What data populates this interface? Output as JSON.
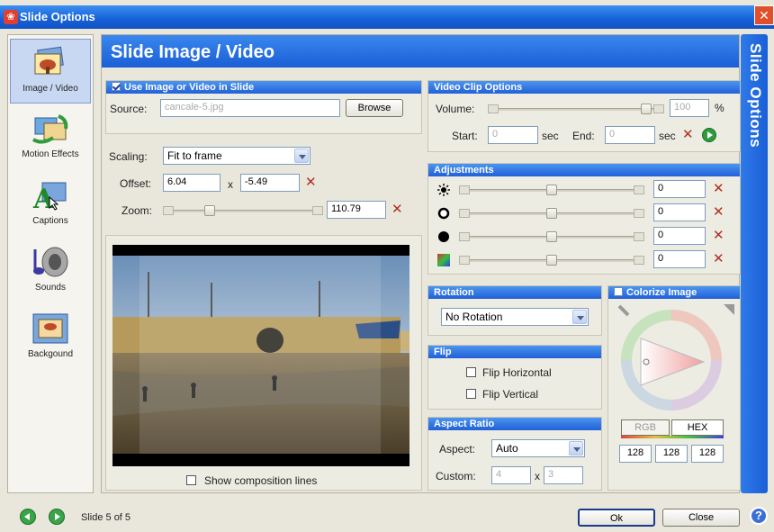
{
  "window": {
    "title": "Slide Options",
    "close_glyph": "✕"
  },
  "sidebar": {
    "items": [
      {
        "label": "Image / Video",
        "icon": "image-icon"
      },
      {
        "label": "Motion Effects",
        "icon": "motion-icon"
      },
      {
        "label": "Captions",
        "icon": "captions-icon"
      },
      {
        "label": "Sounds",
        "icon": "sounds-icon"
      },
      {
        "label": "Backgound",
        "icon": "background-icon"
      }
    ]
  },
  "right_panel": {
    "title": "Slide Options"
  },
  "main": {
    "title": "Slide Image / Video"
  },
  "use_image": {
    "header": "Use Image or Video in Slide",
    "source_label": "Source:",
    "source_value": "cancale-5.jpg",
    "browse": "Browse"
  },
  "scaling": {
    "label": "Scaling:",
    "value": "Fit to frame",
    "offset_label": "Offset:",
    "offset_x": "6.04",
    "offset_y": "-5.49",
    "sep": "x",
    "zoom_label": "Zoom:",
    "zoom_value": "110.79",
    "zoom_pct": 22
  },
  "preview": {
    "composition_label": "Show composition lines"
  },
  "video": {
    "header": "Video Clip Options",
    "volume_label": "Volume:",
    "volume_value": "100",
    "volume_unit": "%",
    "start_label": "Start:",
    "start_value": "0",
    "start_unit": "sec",
    "end_label": "End:",
    "end_value": "0",
    "end_unit": "sec"
  },
  "adjustments": {
    "header": "Adjustments",
    "rows": [
      {
        "icon": "brightness-icon",
        "value": "0"
      },
      {
        "icon": "contrast-icon",
        "value": "0"
      },
      {
        "icon": "gamma-icon",
        "value": "0"
      },
      {
        "icon": "hue-icon",
        "value": "0"
      }
    ]
  },
  "rotation": {
    "header": "Rotation",
    "value": "No Rotation"
  },
  "flip": {
    "header": "Flip",
    "horizontal": "Flip Horizontal",
    "vertical": "Flip Vertical"
  },
  "aspect": {
    "header": "Aspect Ratio",
    "aspect_label": "Aspect:",
    "aspect_value": "Auto",
    "custom_label": "Custom:",
    "custom_w": "4",
    "sep": "x",
    "custom_h": "3"
  },
  "colorize": {
    "header": "Colorize Image",
    "rgb": "RGB",
    "hex": "HEX",
    "r": "128",
    "g": "128",
    "b": "128"
  },
  "footer": {
    "slide_status": "Slide 5 of 5",
    "ok": "Ok",
    "close": "Close",
    "help": "?"
  }
}
